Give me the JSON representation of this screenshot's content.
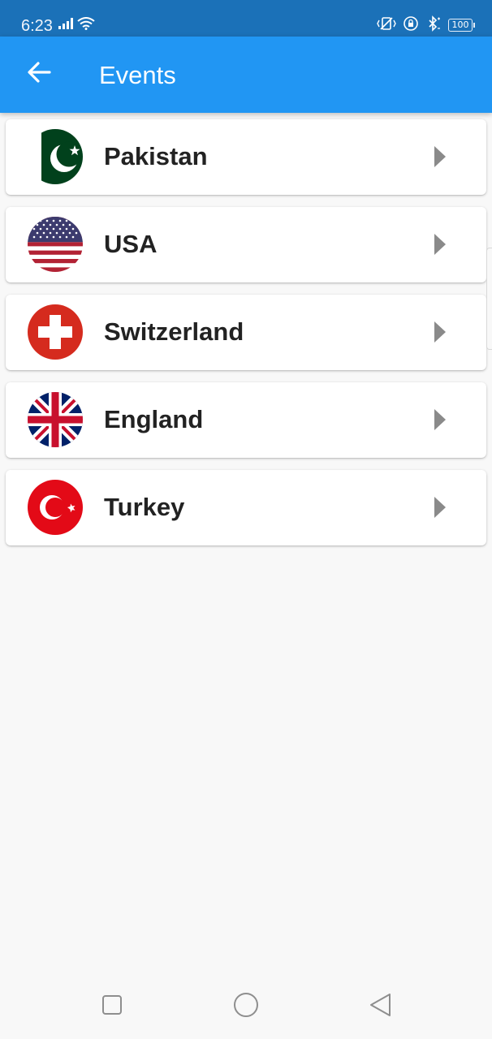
{
  "status_bar": {
    "time": "6:23",
    "battery": "100",
    "icons": [
      "signal-icon",
      "wifi-icon",
      "vibrate-icon",
      "lock-rotation-icon",
      "bluetooth-icon",
      "battery-icon"
    ]
  },
  "app_bar": {
    "title": "Events",
    "back_icon": "arrow-left-icon",
    "background": "#2196f3"
  },
  "countries": [
    {
      "name": "Pakistan",
      "flag": "pakistan-flag-icon"
    },
    {
      "name": "USA",
      "flag": "usa-flag-icon"
    },
    {
      "name": "Switzerland",
      "flag": "switzerland-flag-icon"
    },
    {
      "name": "England",
      "flag": "uk-flag-icon"
    },
    {
      "name": "Turkey",
      "flag": "turkey-flag-icon"
    }
  ],
  "nav_bar": {
    "buttons": [
      "recent-apps-icon",
      "home-icon",
      "back-triangle-icon"
    ]
  }
}
